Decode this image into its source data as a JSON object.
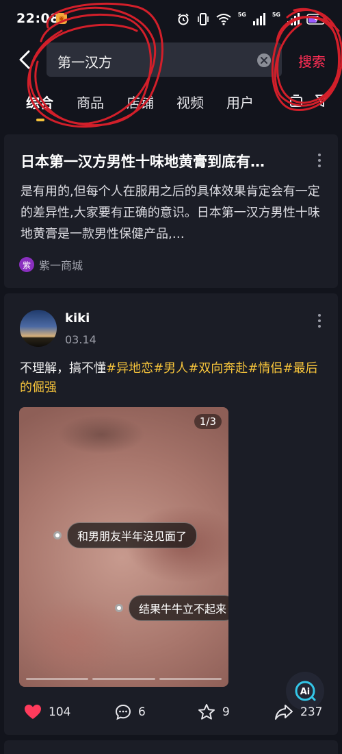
{
  "status_bar": {
    "time": "22:08",
    "network_labels": [
      "5G",
      "5G"
    ]
  },
  "search": {
    "query": "第一汉方",
    "submit_label": "搜索"
  },
  "tabs": [
    {
      "label": "综合",
      "active": true
    },
    {
      "label": "商品",
      "active": false
    },
    {
      "label": "店铺",
      "active": false
    },
    {
      "label": "视频",
      "active": false
    },
    {
      "label": "用户",
      "active": false
    }
  ],
  "article": {
    "title": "日本第一汉方男性十味地黄膏到底有…",
    "snippet": "是有用的,但每个人在服用之后的具体效果肯定会有一定的差异性,大家要有正确的意识。日本第一汉方男性十味地黄膏是一款男性保健产品,…",
    "source_icon_char": "紫",
    "source_name": "紫一商城"
  },
  "post": {
    "username": "kiki",
    "date": "03.14",
    "text_plain": "不理解，搞不懂",
    "tags": [
      "#异地恋",
      "#男人",
      "#双向奔赴",
      "#情侣",
      "#最后的倔强"
    ],
    "image_counter": "1/3",
    "image_tags": [
      "和男朋友半年没见面了",
      "结果牛牛立不起来"
    ],
    "ai_label": "Ai",
    "likes": "104",
    "comments": "6",
    "favorites": "9",
    "shares": "237"
  },
  "colors": {
    "background": "#12141c",
    "card": "#1b1d26",
    "accent_red": "#ff2e55",
    "tag_yellow": "#f5c33b",
    "annotation_red": "#d21f2a"
  }
}
